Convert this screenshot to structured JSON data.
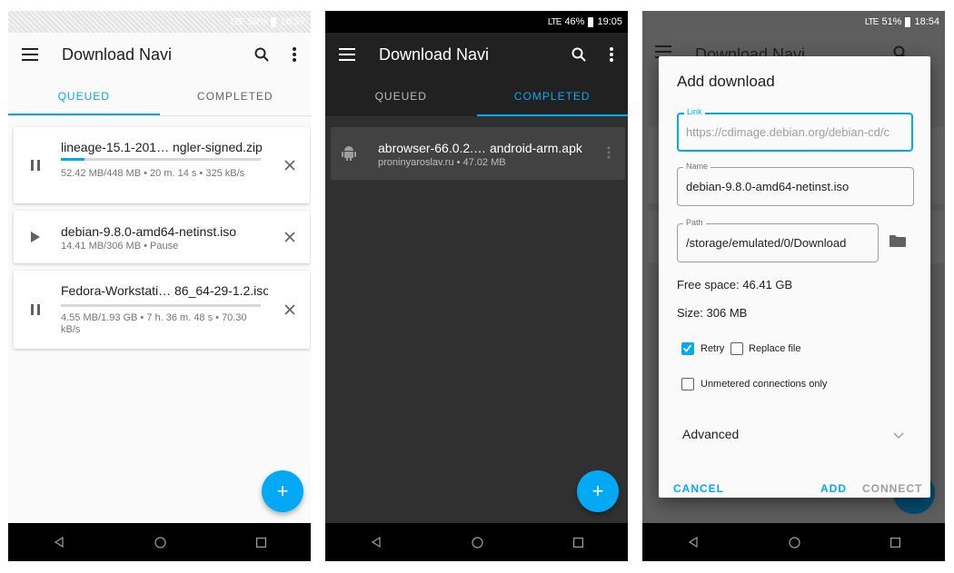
{
  "app": {
    "title": "Download Navi"
  },
  "screen1": {
    "status": {
      "signal": "LTE",
      "battery": "50%",
      "time": "18:57"
    },
    "tabs": [
      "QUEUED",
      "COMPLETED"
    ],
    "downloads": [
      {
        "name": "lineage-15.1-201… ngler-signed.zip",
        "meta": "52.42 MB/448 MB • 20 m. 14 s • 325 kB/s",
        "progress": 0.12,
        "state": "pause-icon"
      },
      {
        "name": "debian-9.8.0-amd64-netinst.iso",
        "meta": "14.41 MB/306 MB • Pause",
        "state": "play-icon"
      },
      {
        "name": "Fedora-Workstati… 86_64-29-1.2.iso",
        "meta": "4.55 MB/1.93 GB • 7 h. 36 m. 48 s • 70.30 kB/s",
        "progress": 0.0,
        "state": "pause-icon"
      }
    ],
    "fab": "+"
  },
  "screen2": {
    "status": {
      "signal": "LTE",
      "battery": "46%",
      "time": "19:05"
    },
    "tabs": [
      "QUEUED",
      "COMPLETED"
    ],
    "completed": [
      {
        "name": "abrowser-66.0.2.… android-arm.apk",
        "meta": "proninyaroslav.ru • 47.02 MB",
        "icon": "android-icon"
      }
    ],
    "fab": "+"
  },
  "screen3": {
    "status": {
      "signal": "LTE",
      "battery": "51%",
      "time": "18:54"
    },
    "background_title": "Download Navi",
    "dialog": {
      "title": "Add download",
      "link": {
        "label": "Link",
        "placeholder": "https://cdimage.debian.org/debian-cd/c"
      },
      "name": {
        "label": "Name",
        "value": "debian-9.8.0-amd64-netinst.iso"
      },
      "path": {
        "label": "Path",
        "value": "/storage/emulated/0/Download"
      },
      "free_space": "Free space: 46.41 GB",
      "size": "Size: 306 MB",
      "retry": {
        "label": "Retry",
        "checked": true
      },
      "replace": {
        "label": "Replace file",
        "checked": false
      },
      "unmetered": {
        "label": "Unmetered connections only",
        "checked": false
      },
      "advanced": "Advanced",
      "buttons": {
        "cancel": "CANCEL",
        "add": "ADD",
        "connect": "CONNECT"
      }
    }
  },
  "colors": {
    "accent": "#03a9f4",
    "dark_bg": "#303030",
    "dark_card": "#424242",
    "light_bg": "#fafafa"
  }
}
